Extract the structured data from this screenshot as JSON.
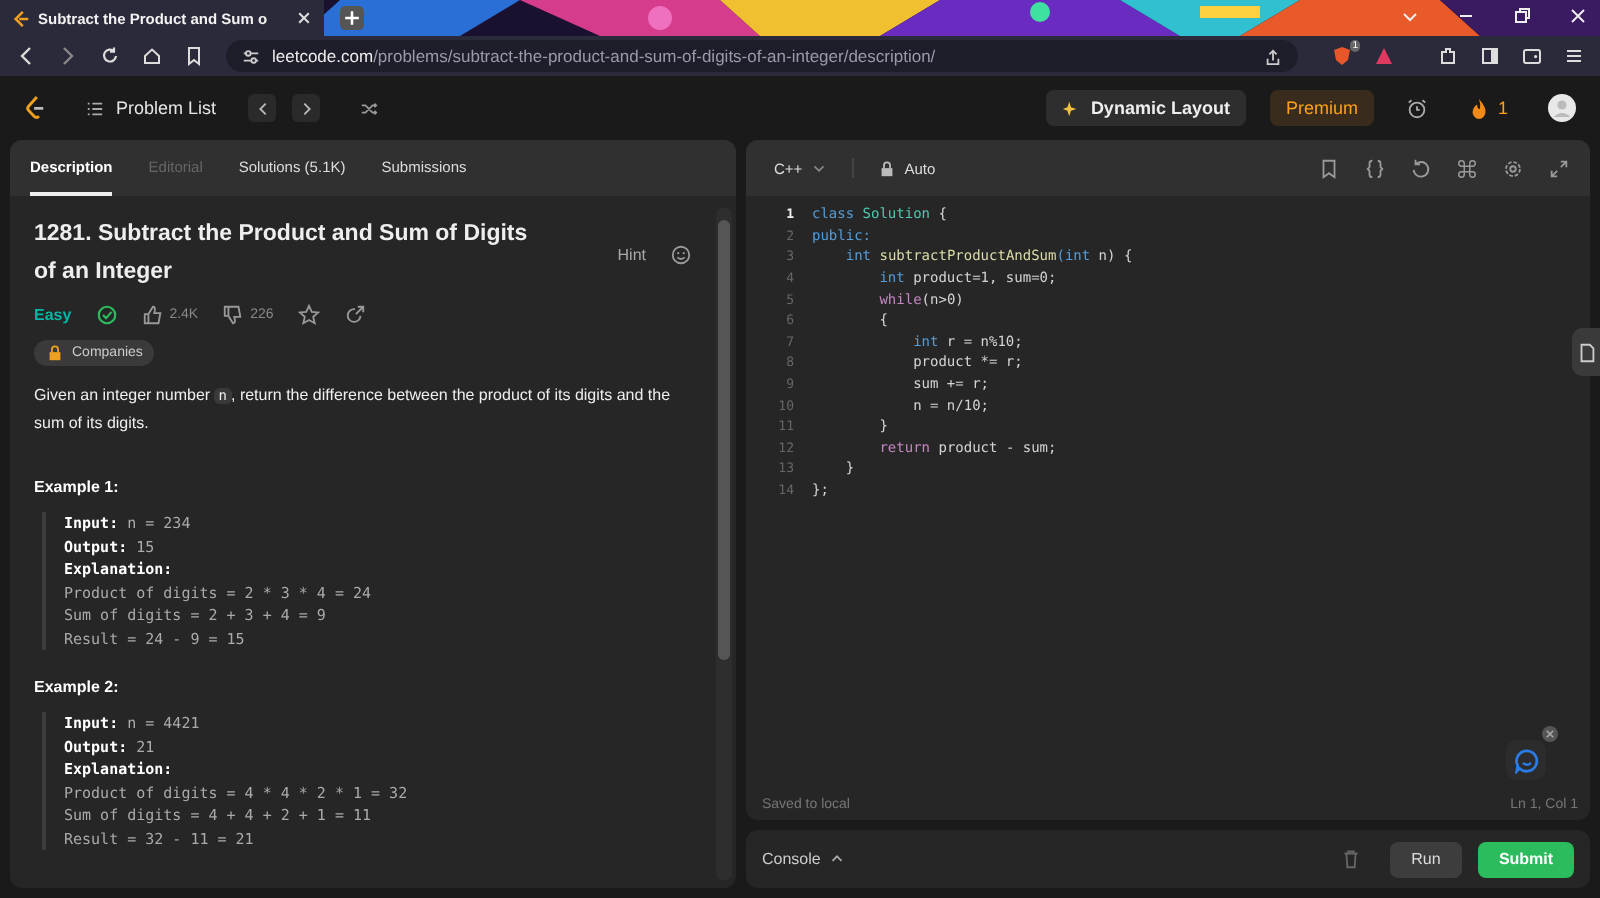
{
  "browser": {
    "tab_title": "Subtract the Product and Sum o",
    "url_host": "leetcode.com",
    "url_path": "/problems/subtract-the-product-and-sum-of-digits-of-an-integer/description/",
    "shields_count": "1"
  },
  "nav": {
    "problem_list": "Problem List",
    "dynamic_layout": "Dynamic Layout",
    "premium": "Premium",
    "streak": "1"
  },
  "tabs": [
    {
      "label": "Description",
      "selected": true,
      "disabled": false
    },
    {
      "label": "Editorial",
      "selected": false,
      "disabled": true
    },
    {
      "label": "Solutions (5.1K)",
      "selected": false,
      "disabled": false
    },
    {
      "label": "Submissions",
      "selected": false,
      "disabled": false
    }
  ],
  "problem": {
    "title": "1281. Subtract the Product and Sum of Digits of an Integer",
    "hint": "Hint",
    "difficulty": "Easy",
    "solved": true,
    "likes": "2.4K",
    "dislikes": "226",
    "companies": "Companies",
    "description": [
      {
        "text": "Given an integer number ",
        "kind": "text"
      },
      {
        "text": "n",
        "kind": "code"
      },
      {
        "text": ", return the difference between the product of its digits and the sum of its digits.",
        "kind": "text"
      }
    ]
  },
  "examples": [
    {
      "title": "Example 1:",
      "lines": [
        {
          "label": "Input:",
          "value": "n = 234"
        },
        {
          "label": "Output:",
          "value": "15"
        },
        {
          "label": "Explanation:"
        },
        {
          "value": "Product of digits = 2 * 3 * 4 = 24"
        },
        {
          "value": "Sum of digits = 2 + 3 + 4 = 9"
        },
        {
          "value": "Result = 24 - 9 = 15"
        }
      ]
    },
    {
      "title": "Example 2:",
      "lines": [
        {
          "label": "Input:",
          "value": "n = 4421"
        },
        {
          "label": "Output:",
          "value": "21"
        },
        {
          "label": "Explanation:"
        },
        {
          "value": "Product of digits = 4 * 4 * 2 * 1 = 32"
        },
        {
          "value": "Sum of digits = 4 + 4 + 2 + 1 = 11"
        },
        {
          "value": "Result = 32 - 11 = 21"
        }
      ]
    }
  ],
  "editor": {
    "language": "C++",
    "mode": "Auto",
    "status": "Saved to local",
    "cursor": "Ln 1, Col 1",
    "lines": [
      {
        "number": "1",
        "selected": true,
        "tokens": [
          {
            "text": "class",
            "kind": "keyword"
          },
          {
            "text": " Solution",
            "kind": "type"
          },
          {
            "text": " {",
            "kind": "plain"
          }
        ]
      },
      {
        "number": "2",
        "selected": false,
        "tokens": [
          {
            "text": "public:",
            "kind": "keyword"
          }
        ]
      },
      {
        "number": "3",
        "selected": false,
        "tokens": [
          {
            "text": "    int",
            "kind": "keyword"
          },
          {
            "text": " subtractProductAndSum",
            "kind": "function"
          },
          {
            "text": "(int",
            "kind": "keyword"
          },
          {
            "text": " n) {",
            "kind": "plain"
          }
        ]
      },
      {
        "number": "4",
        "selected": false,
        "tokens": [
          {
            "text": "        int",
            "kind": "keyword"
          },
          {
            "text": " product=1, sum=0;",
            "kind": "plain"
          }
        ]
      },
      {
        "number": "5",
        "selected": false,
        "tokens": [
          {
            "text": "        while",
            "kind": "control"
          },
          {
            "text": "(n>0)",
            "kind": "plain"
          }
        ]
      },
      {
        "number": "6",
        "selected": false,
        "tokens": [
          {
            "text": "        {",
            "kind": "plain"
          }
        ]
      },
      {
        "number": "7",
        "selected": false,
        "tokens": [
          {
            "text": "            int",
            "kind": "keyword"
          },
          {
            "text": " r = n%10;",
            "kind": "plain"
          }
        ]
      },
      {
        "number": "8",
        "selected": false,
        "tokens": [
          {
            "text": "            product *= r;",
            "kind": "plain"
          }
        ]
      },
      {
        "number": "9",
        "selected": false,
        "tokens": [
          {
            "text": "            sum += r;",
            "kind": "plain"
          }
        ]
      },
      {
        "number": "10",
        "selected": false,
        "tokens": [
          {
            "text": "            n = n/10;",
            "kind": "plain"
          }
        ]
      },
      {
        "number": "11",
        "selected": false,
        "tokens": [
          {
            "text": "        }",
            "kind": "plain"
          }
        ]
      },
      {
        "number": "12",
        "selected": false,
        "tokens": [
          {
            "text": "        return",
            "kind": "control"
          },
          {
            "text": " product - sum;",
            "kind": "plain"
          }
        ]
      },
      {
        "number": "13",
        "selected": false,
        "tokens": [
          {
            "text": "    }",
            "kind": "plain"
          }
        ]
      },
      {
        "number": "14",
        "selected": false,
        "tokens": [
          {
            "text": "};",
            "kind": "plain"
          }
        ]
      }
    ]
  },
  "console": {
    "label": "Console",
    "run": "Run",
    "submit": "Submit"
  }
}
